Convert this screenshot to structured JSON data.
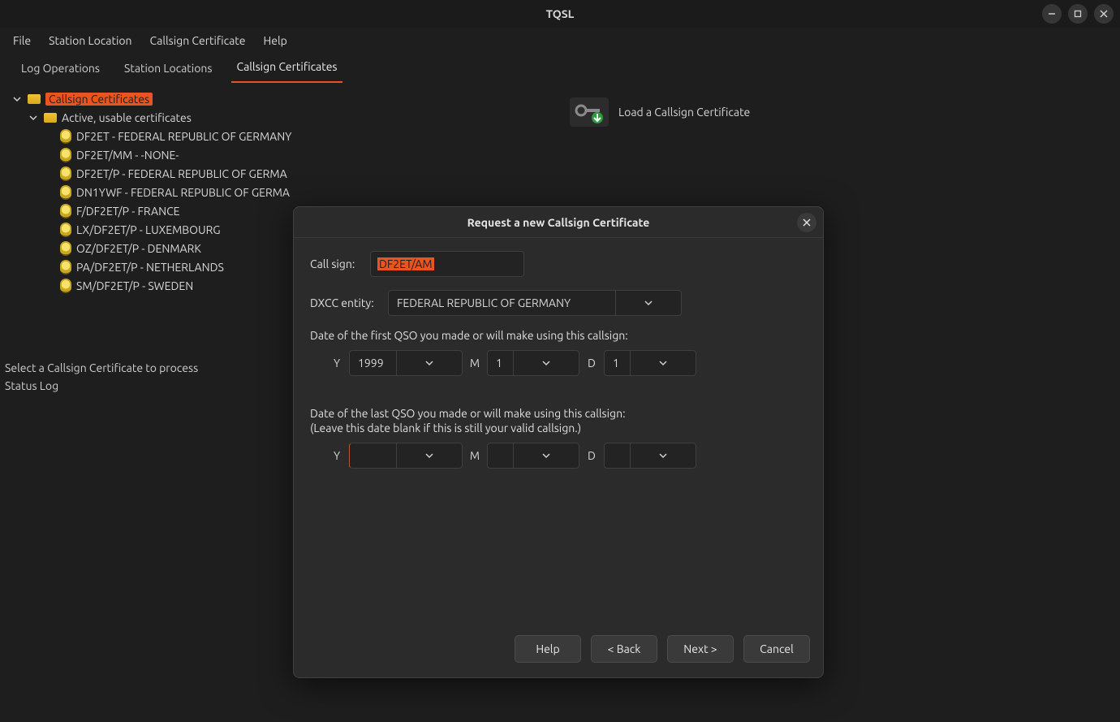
{
  "window": {
    "title": "TQSL"
  },
  "menubar": [
    "File",
    "Station Location",
    "Callsign Certificate",
    "Help"
  ],
  "tabs": [
    {
      "label": "Log Operations",
      "active": false
    },
    {
      "label": "Station Locations",
      "active": false
    },
    {
      "label": "Callsign Certificates",
      "active": true
    }
  ],
  "sidebar": {
    "root_label": "Callsign Certificates",
    "active_group_label": "Active, usable certificates",
    "certs": [
      "DF2ET - FEDERAL REPUBLIC OF GERMANY",
      "DF2ET/MM - -NONE-",
      "DF2ET/P - FEDERAL REPUBLIC OF GERMA",
      "DN1YWF - FEDERAL REPUBLIC OF GERMA",
      "F/DF2ET/P - FRANCE",
      "LX/DF2ET/P - LUXEMBOURG",
      "OZ/DF2ET/P - DENMARK",
      "PA/DF2ET/P - NETHERLANDS",
      "SM/DF2ET/P - SWEDEN"
    ]
  },
  "right": {
    "load_label": "Load a Callsign Certificate"
  },
  "hints": {
    "select": "Select a Callsign Certificate to process",
    "status": "Status Log"
  },
  "dialog": {
    "title": "Request a new Callsign Certificate",
    "callsign_label": "Call sign:",
    "callsign_value": "DF2ET/AM",
    "dxcc_label": "DXCC entity:",
    "dxcc_value": "FEDERAL REPUBLIC OF GERMANY",
    "first_qso_label": "Date of the first QSO you made or will make using this callsign:",
    "last_qso_label_1": "Date of the last QSO you made or will make using this callsign:",
    "last_qso_label_2": "(Leave this date blank if this is still your valid callsign.)",
    "date_labels": {
      "y": "Y",
      "m": "M",
      "d": "D"
    },
    "first_qso": {
      "y": "1999",
      "m": "1",
      "d": "1"
    },
    "last_qso": {
      "y": "",
      "m": "",
      "d": ""
    },
    "buttons": {
      "help": "Help",
      "back": "< Back",
      "next": "Next >",
      "cancel": "Cancel"
    }
  }
}
